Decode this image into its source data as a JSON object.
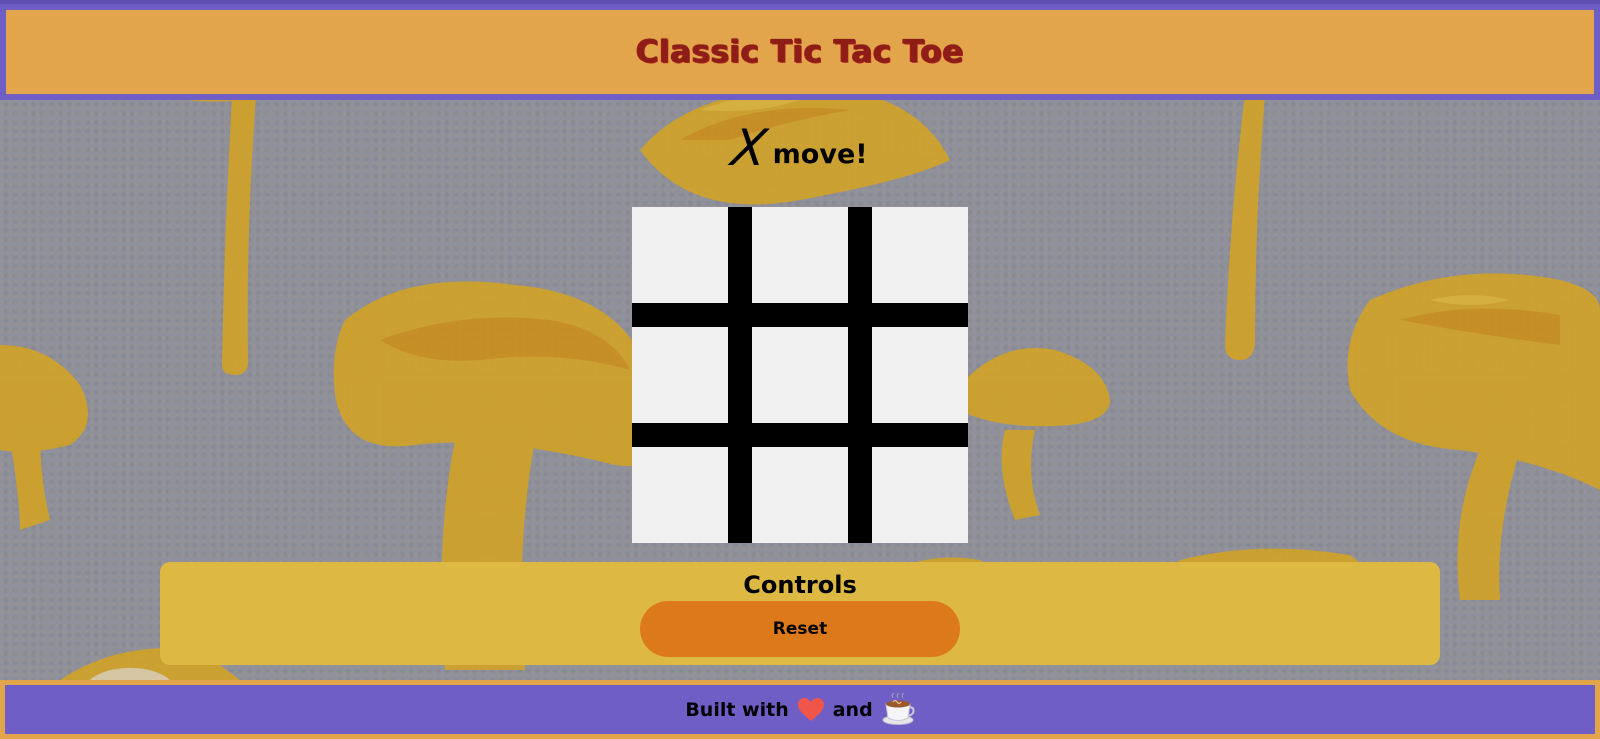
{
  "header": {
    "title": "Classic Tic Tac Toe"
  },
  "status": {
    "mark": "X",
    "text": "move!"
  },
  "board": {
    "cells": [
      "",
      "",
      "",
      "",
      "",
      "",
      "",
      "",
      ""
    ]
  },
  "controls": {
    "title": "Controls",
    "reset_label": "Reset"
  },
  "footer": {
    "built_with": "Built with",
    "and": "and",
    "icons": [
      "heart-icon",
      "coffee-icon"
    ]
  },
  "colors": {
    "header_bg": "#e3a54c",
    "accent_purple": "#705ec7",
    "title_red": "#8e1c17",
    "controls_bg": "#ddb943",
    "reset_bg": "#dc7a1b",
    "cell_bg": "#f0f0f0",
    "grid_line": "#000000"
  }
}
